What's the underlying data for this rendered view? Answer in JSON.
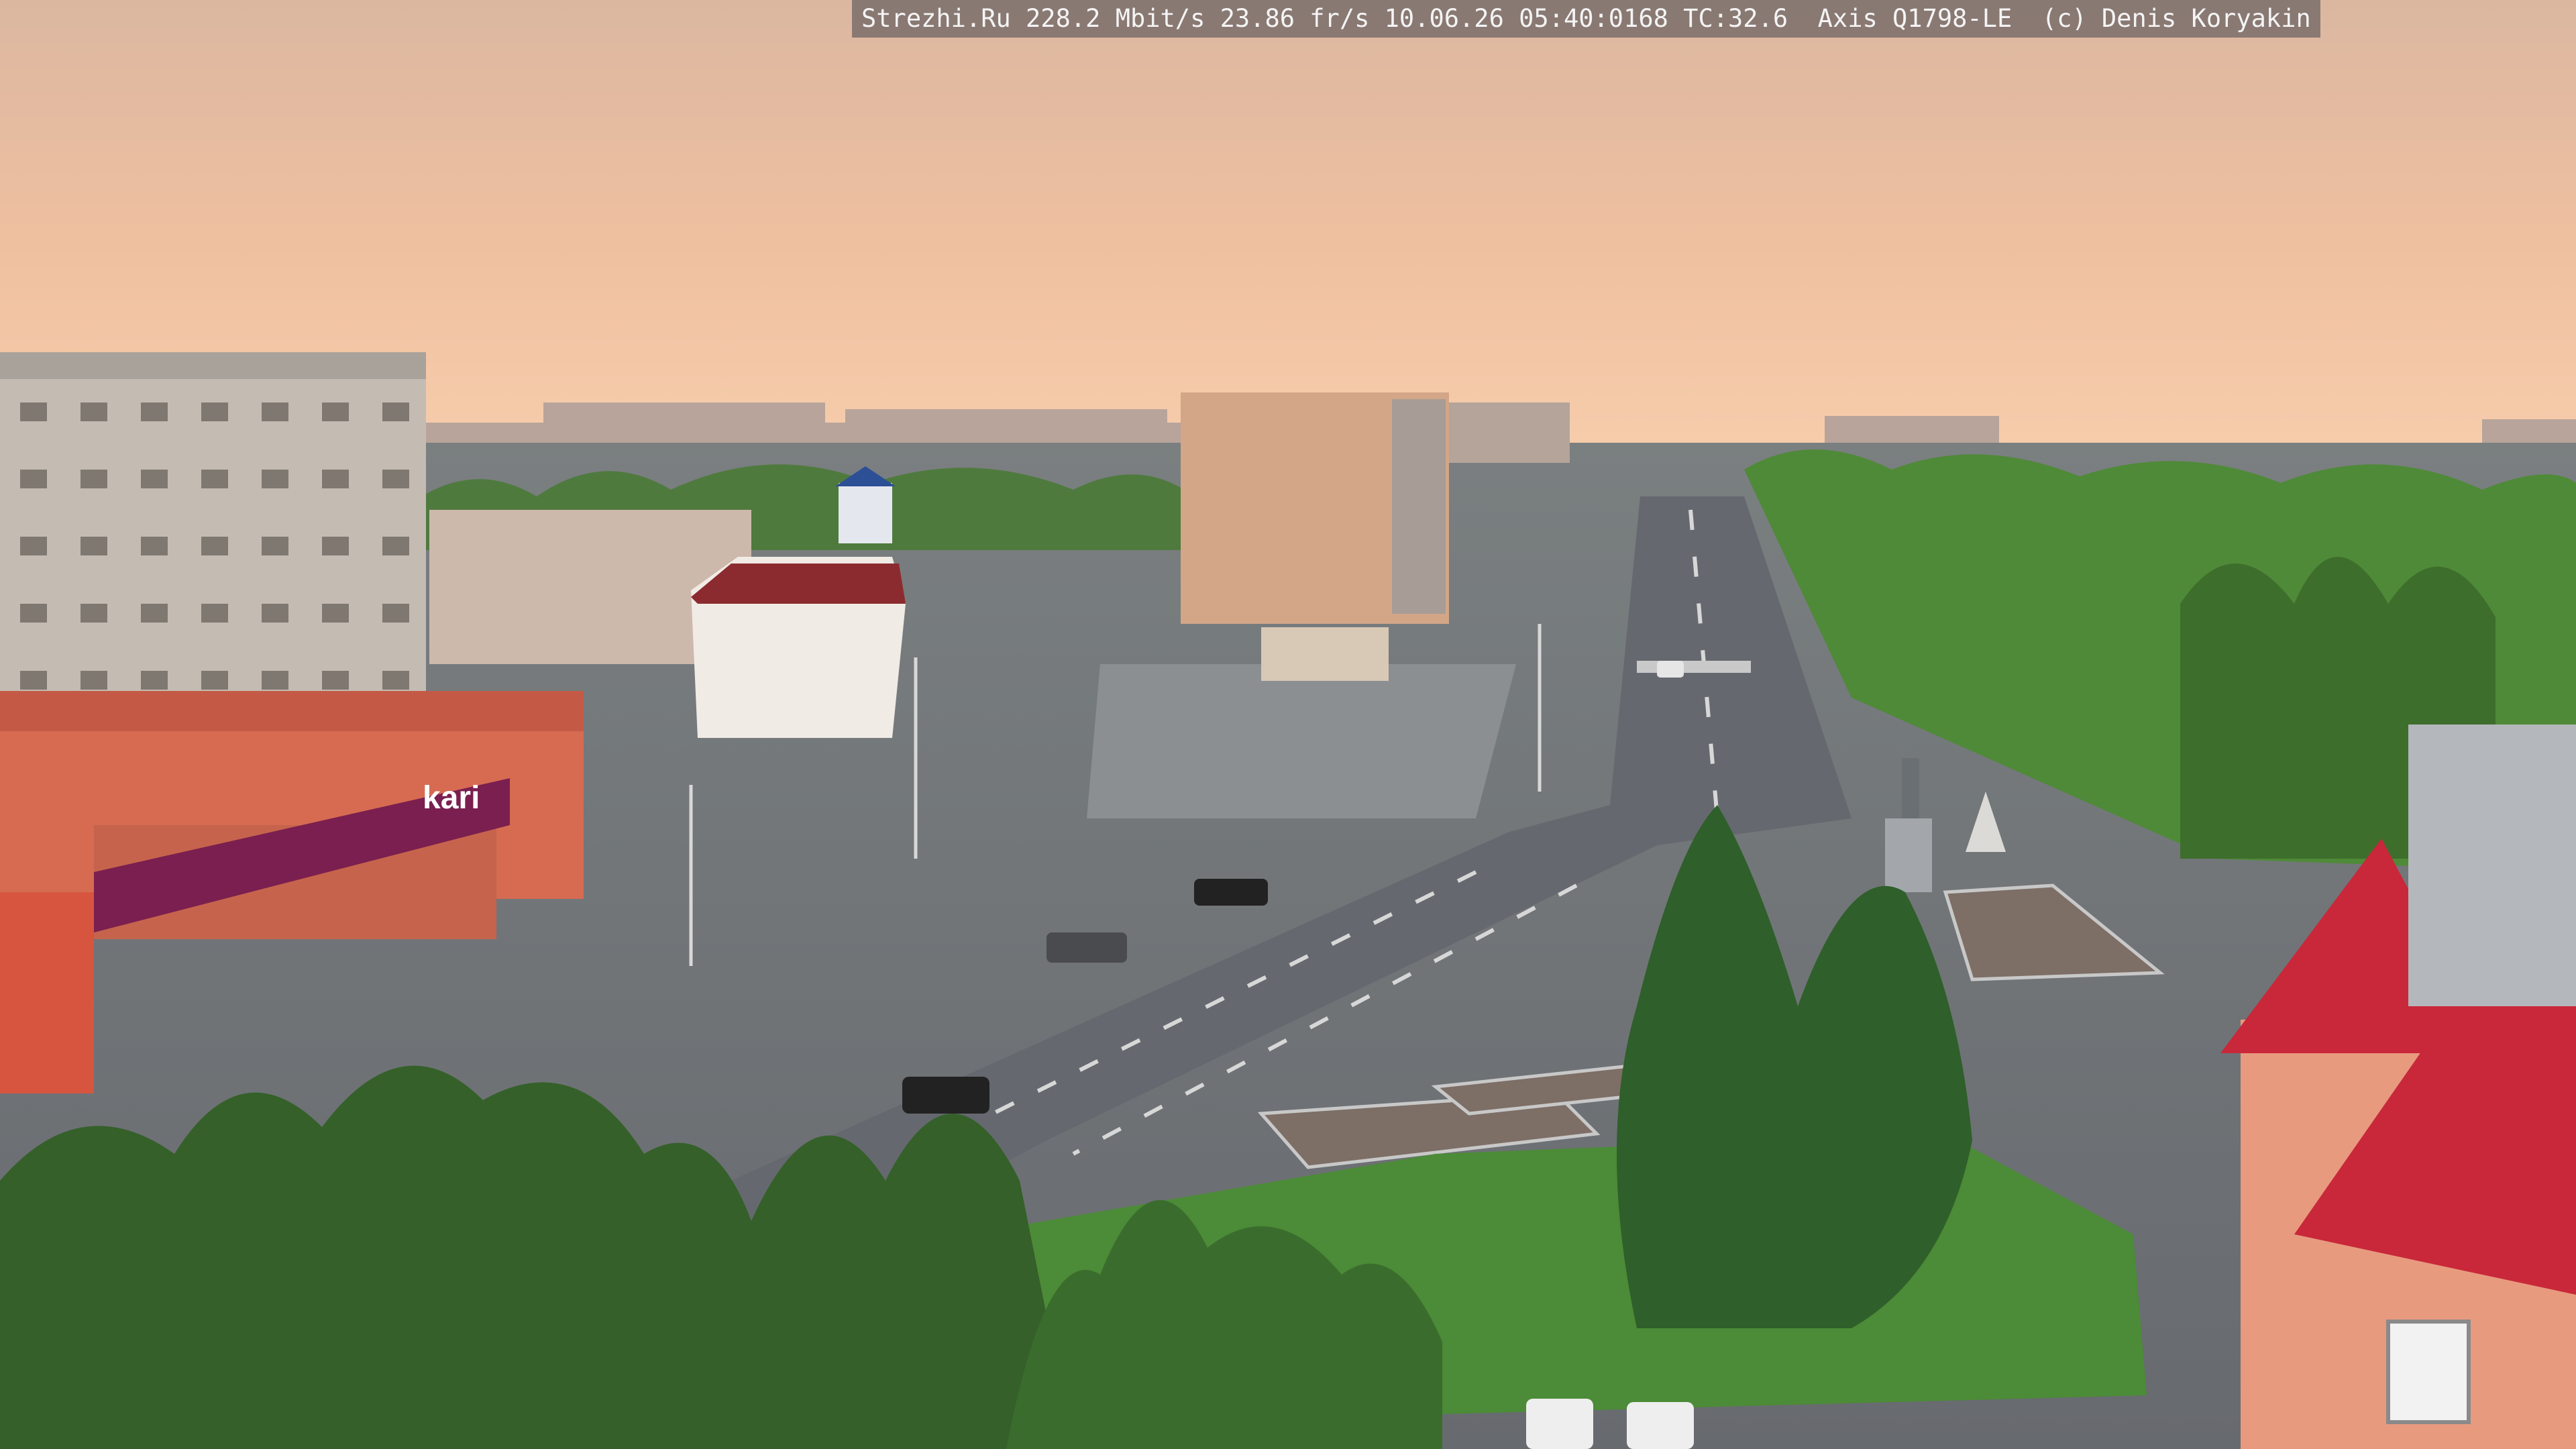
{
  "osd": {
    "text": "Strezhi.Ru 228.2 Mbit/s 23.86 fr/s 10.06.26 05:40:0168 TC:32.6  Axis Q1798-LE  (c) Denis Koryakin"
  },
  "signs": {
    "store_name": "kari"
  },
  "colors": {
    "sky_top": "#e9c0a2",
    "sky_horizon": "#f4c9a6",
    "road": "#6b6f75",
    "grass": "#4d8a3a",
    "trees": "#3f6e2e",
    "roof_red": "#c8283a",
    "store_banner": "#7a1f4f"
  }
}
